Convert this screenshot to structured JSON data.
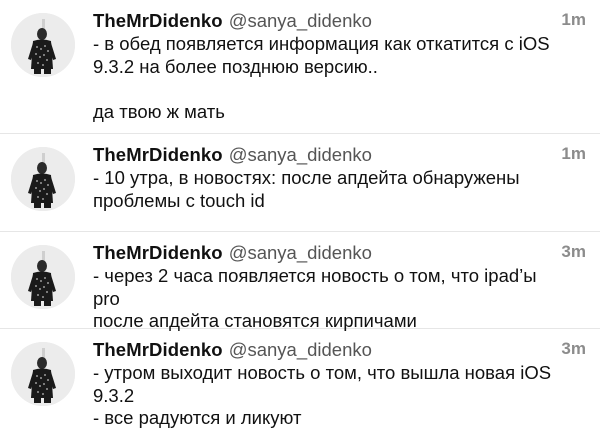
{
  "feed": {
    "tweets": [
      {
        "display_name": "TheMrDidenko",
        "screen_name": "@sanya_didenko",
        "time": "1m",
        "text": "- в обед появляется информация как откатится с iOS\n9.3.2 на более позднюю версию..\n\nда твою ж мать",
        "avatar_icon": "user-avatar-icon"
      },
      {
        "display_name": "TheMrDidenko",
        "screen_name": "@sanya_didenko",
        "time": "1m",
        "text": "- 10 утра, в новостях: после апдейта обнаружены\nпроблемы с touch id",
        "avatar_icon": "user-avatar-icon"
      },
      {
        "display_name": "TheMrDidenko",
        "screen_name": "@sanya_didenko",
        "time": "3m",
        "text": "- через 2 часа появляется новость о том, что ipad’ы pro\nпосле апдейта становятся кирпичами",
        "avatar_icon": "user-avatar-icon"
      },
      {
        "display_name": "TheMrDidenko",
        "screen_name": "@sanya_didenko",
        "time": "3m",
        "text": "- утром выходит новость о том, что вышла новая iOS\n9.3.2\n- все радуются и ликуют",
        "avatar_icon": "user-avatar-icon"
      }
    ]
  },
  "colors": {
    "name": "#111111",
    "handle": "#555555",
    "timestamp": "#8c8c8c",
    "divider": "#e6e6e6"
  }
}
